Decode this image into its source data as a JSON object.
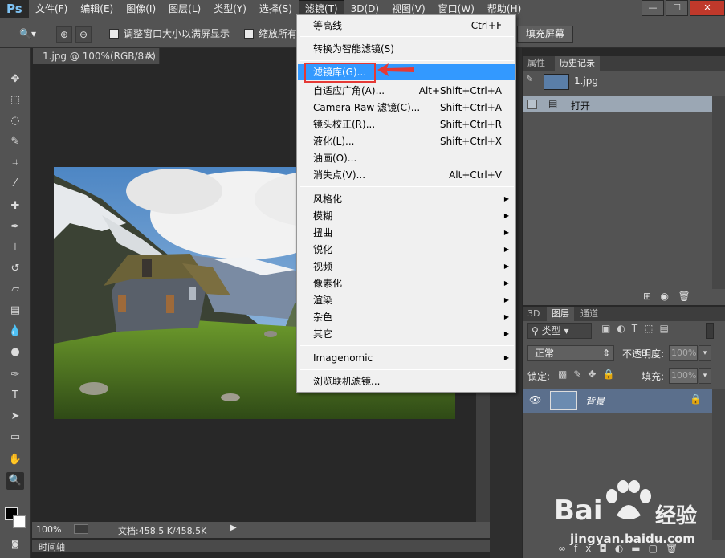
{
  "app": {
    "logo": "Ps",
    "colors": {
      "menu_highlight": "#3399ff",
      "annotation": "#e53935",
      "panel_bg": "#535353",
      "layer_selected": "#5b6f8c"
    }
  },
  "menubar": {
    "items": [
      "文件(F)",
      "编辑(E)",
      "图像(I)",
      "图层(L)",
      "类型(Y)",
      "选择(S)",
      "滤镜(T)",
      "3D(D)",
      "视图(V)",
      "窗口(W)",
      "帮助(H)"
    ],
    "active": "滤镜(T)"
  },
  "window_controls": {
    "minimize": "—",
    "restore": "☐",
    "close": "✕"
  },
  "options": {
    "resize_windows_label": "调整窗口大小以满屏显示",
    "zoom_all_label": "缩放所有",
    "fill_screen_label": "填充屏幕"
  },
  "document": {
    "tab_title": "1.jpg @ 100%(RGB/8#)",
    "tab_close": "×"
  },
  "statusbar": {
    "zoom": "100%",
    "doc_size": "文档:458.5 K/458.5K",
    "timeline_label": "时间轴"
  },
  "filter_menu": {
    "group1": [
      {
        "label": "等高线",
        "shortcut": "Ctrl+F"
      }
    ],
    "group2": [
      {
        "label": "转换为智能滤镜(S)"
      }
    ],
    "group3": [
      {
        "label": "滤镜库(G)...",
        "shortcut": ""
      },
      {
        "label": "自适应广角(A)...",
        "shortcut": "Alt+Shift+Ctrl+A"
      },
      {
        "label": "Camera Raw 滤镜(C)...",
        "shortcut": "Shift+Ctrl+A"
      },
      {
        "label": "镜头校正(R)...",
        "shortcut": "Shift+Ctrl+R"
      },
      {
        "label": "液化(L)...",
        "shortcut": "Shift+Ctrl+X"
      },
      {
        "label": "油画(O)...",
        "shortcut": ""
      },
      {
        "label": "消失点(V)...",
        "shortcut": "Alt+Ctrl+V"
      }
    ],
    "group4": [
      "风格化",
      "模糊",
      "扭曲",
      "锐化",
      "视频",
      "像素化",
      "渲染",
      "杂色",
      "其它"
    ],
    "group5": [
      "Imagenomic"
    ],
    "group6": [
      {
        "label": "浏览联机滤镜..."
      }
    ],
    "highlighted": "滤镜库(G)..."
  },
  "history_panel": {
    "tabs": [
      "属性",
      "历史记录"
    ],
    "active_tab": "历史记录",
    "snapshot_label": "1.jpg",
    "states": [
      "打开"
    ]
  },
  "layers_panel": {
    "tabs": [
      "3D",
      "图层",
      "通道"
    ],
    "active_tab": "图层",
    "filter_kind": "类型",
    "blend_mode": "正常",
    "opacity_label": "不透明度:",
    "opacity_value": "100%",
    "lock_label": "锁定:",
    "fill_label": "填充:",
    "fill_value": "100%",
    "layers": [
      {
        "name": "背景",
        "visible": true,
        "locked": true
      }
    ]
  },
  "watermark": {
    "brand": "Bai",
    "brand2": "经验",
    "url": "jingyan.baidu.com"
  }
}
